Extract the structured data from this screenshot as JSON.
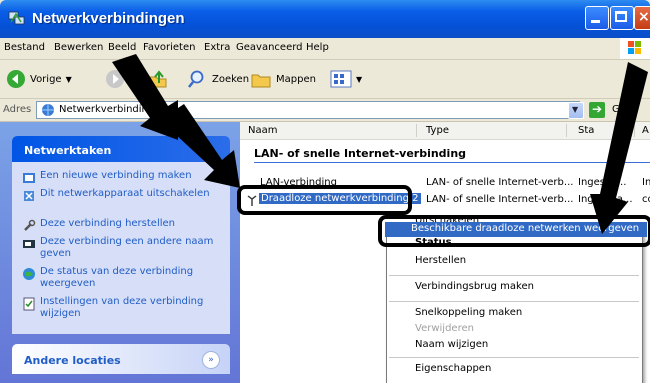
{
  "window": {
    "title": "Netwerkverbindingen"
  },
  "menu": [
    "Bestand",
    "Bewerken",
    "Beeld",
    "Favorieten",
    "Extra",
    "Geavanceerd",
    "Help"
  ],
  "toolbar": {
    "back": "Vorige",
    "search": "Zoeken",
    "folders": "Mappen"
  },
  "address": {
    "label": "Adres",
    "value": "Netwerkverbindingen",
    "go": "G"
  },
  "tasks": {
    "header": "Netwerktaken",
    "items": [
      "Een nieuwe verbinding maken",
      "Dit netwerkapparaat uitschakelen",
      "Deze verbinding herstellen",
      "Deze verbinding een andere naam geven",
      "De status van deze verbinding weergeven",
      "Instellingen van deze verbinding wijzigen"
    ]
  },
  "other": {
    "header": "Andere locaties"
  },
  "columns": [
    "Naam",
    "Type",
    "Sta",
    "A"
  ],
  "group": "LAN- of snelle Internet-verbinding",
  "rows": [
    {
      "name": "LAN-verbinding",
      "type": "LAN- of snelle Internet-verb...",
      "status": "Ingesch...",
      "extra": "In"
    },
    {
      "name": "Draadloze netwerkverbinding 2",
      "type": "LAN- of snelle Internet-verb...",
      "status": "Ingescha...",
      "extra": "co"
    }
  ],
  "context_menu": {
    "top_partial": "Uitschakelen",
    "highlighted": "Beschikbare draadloze netwerken weergeven",
    "status": "Status",
    "items": [
      "Herstellen",
      "Verbindingsbrug maken",
      "Snelkoppeling maken",
      "Verwijderen",
      "Naam wijzigen",
      "Eigenschappen"
    ]
  }
}
